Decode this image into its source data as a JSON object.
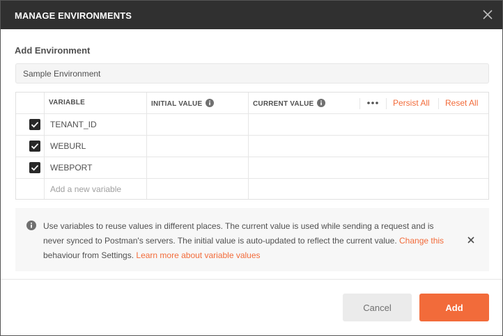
{
  "dialog": {
    "title": "MANAGE ENVIRONMENTS",
    "section_label": "Add Environment",
    "environment_name": "Sample Environment"
  },
  "table": {
    "headers": {
      "variable": "VARIABLE",
      "initial_value": "INITIAL VALUE",
      "current_value": "CURRENT VALUE"
    },
    "actions": {
      "persist_all": "Persist All",
      "reset_all": "Reset All"
    },
    "rows": [
      {
        "checked": true,
        "variable": "TENANT_ID",
        "initial_value": "",
        "current_value": ""
      },
      {
        "checked": true,
        "variable": "WEBURL",
        "initial_value": "",
        "current_value": ""
      },
      {
        "checked": true,
        "variable": "WEBPORT",
        "initial_value": "",
        "current_value": ""
      }
    ],
    "new_variable_placeholder": "Add a new variable"
  },
  "info": {
    "text_1": "Use variables to reuse values in different places. The current value is used while sending a request and is never synced to Postman's servers. The initial value is auto-updated to reflect the current value. ",
    "link_change": "Change this",
    "text_2": " behaviour from Settings. ",
    "link_learn": "Learn more about variable values"
  },
  "footer": {
    "cancel_label": "Cancel",
    "add_label": "Add"
  },
  "colors": {
    "accent": "#f26b3a",
    "titlebar": "#303030"
  },
  "icons": [
    "close-icon",
    "info-icon",
    "more-horizontal-icon",
    "checkbox-checked-icon"
  ]
}
